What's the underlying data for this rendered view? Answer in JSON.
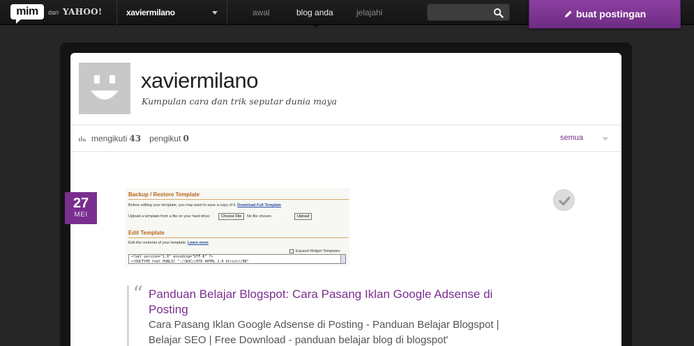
{
  "topbar": {
    "logo": "mim",
    "from_text": "dari",
    "yahoo": "YAHOO!",
    "username": "xaviermilano",
    "nav": [
      {
        "label": "awal",
        "active": false
      },
      {
        "label": "blog anda",
        "active": true
      },
      {
        "label": "jelajahi",
        "active": false
      }
    ],
    "search_placeholder": "",
    "post_button": "buat postingan"
  },
  "profile": {
    "title": "xaviermilano",
    "tagline": "Kumpulan cara dan trik seputar dunia maya"
  },
  "stats": {
    "following_label": "mengikuti",
    "following_count": "43",
    "followers_label": "pengikut",
    "followers_count": "0",
    "filter": "semua"
  },
  "post": {
    "day": "27",
    "month": "MEI",
    "thumbnail": {
      "section1": "Backup / Restore Template",
      "line1_text": "Before editing your template, you may want to save a copy of it.",
      "line1_link": "Download Full Template",
      "line2_text": "Upload a template from a file on your hard drive:",
      "choose_file": "Choose File",
      "no_file": "No file chosen",
      "upload": "Upload",
      "section2": "Edit Template",
      "line3_text": "Edit the contents of your template.",
      "line3_link": "Learn more",
      "expand": "Expand Widget Templates",
      "code1": "<?xml version=\"1.0\" encoding=\"UTF-8\" ?>",
      "code2": "<!DOCTYPE html PUBLIC \"-//W3C//DTD XHTML 1.0 Strict//EN\""
    },
    "quote_title": "Panduan Belajar Blogspot: Cara Pasang Iklan Google Adsense di Posting",
    "quote_body": "Cara Pasang Iklan Google Adsense di Posting - Panduan Belajar Blogspot | Belajar SEO | Free Download - panduan belajar blog di blogspot'"
  },
  "colors": {
    "accent": "#7a2e8e",
    "topbar": "#1a1a1a",
    "background": "#262626"
  }
}
